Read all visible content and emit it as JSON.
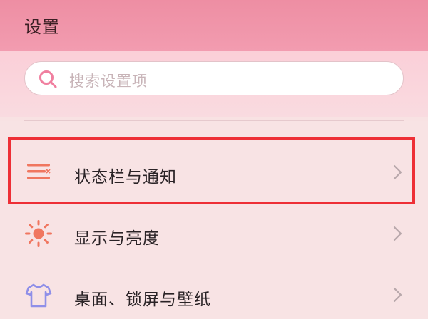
{
  "header": {
    "title": "设置"
  },
  "search": {
    "placeholder": "搜索设置项",
    "icon": "search-icon"
  },
  "menu": {
    "items": [
      {
        "label": "状态栏与通知",
        "icon": "status-bar-notification-icon",
        "highlighted": true
      },
      {
        "label": "显示与亮度",
        "icon": "brightness-icon",
        "highlighted": false
      },
      {
        "label": "桌面、锁屏与壁纸",
        "icon": "tshirt-theme-icon",
        "highlighted": false
      }
    ]
  },
  "colors": {
    "header_bg": "#ee8ea3",
    "accent_icon": "#f0765f",
    "theme_icon": "#8f8fe8",
    "highlight_border": "#ee2f36"
  }
}
